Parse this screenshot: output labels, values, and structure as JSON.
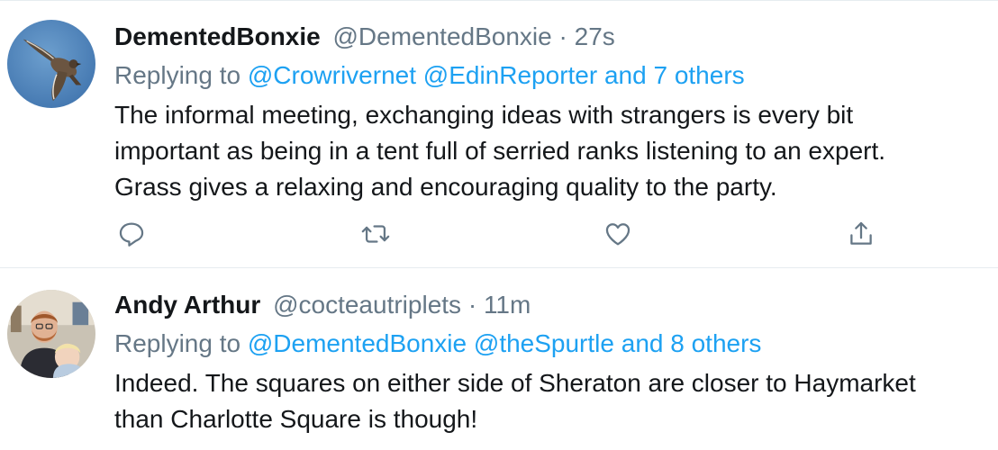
{
  "colors": {
    "link": "#1da1f2",
    "secondary": "#657786",
    "text": "#14171a",
    "divider": "#e6ecf0"
  },
  "tweets": [
    {
      "display_name": "DementedBonxie",
      "handle": "@DementedBonxie",
      "separator": "·",
      "time": "27s",
      "replying_to_label": "Replying to",
      "mentions": [
        "@Crowrivernet",
        "@EdinReporter"
      ],
      "others": "and 7 others",
      "text_lines": [
        "The informal meeting, exchanging ideas with strangers is every bit",
        "important as being in a tent full of serried ranks listening to an expert.",
        "Grass gives a relaxing and encouraging quality to the party."
      ],
      "avatar_icon": "bird-in-flight-avatar",
      "actions": [
        "reply-icon",
        "retweet-icon",
        "like-icon",
        "share-icon"
      ]
    },
    {
      "display_name": "Andy Arthur",
      "handle": "@cocteautriplets",
      "separator": "·",
      "time": "11m",
      "replying_to_label": "Replying to",
      "mentions": [
        "@DementedBonxie",
        "@theSpurtle"
      ],
      "others": "and 8 others",
      "text_lines": [
        "Indeed. The squares on either side of Sheraton are closer to Haymarket",
        "than Charlotte Square is though!"
      ],
      "avatar_icon": "person-with-child-avatar"
    }
  ]
}
